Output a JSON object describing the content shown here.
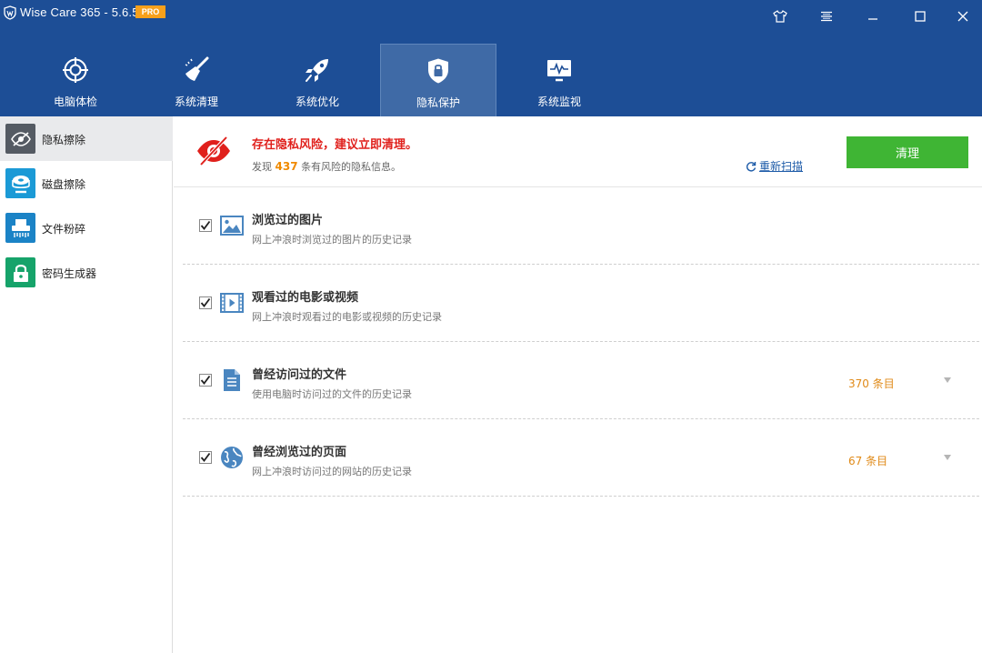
{
  "titlebar": {
    "title": "Wise Care 365 - 5.6.5",
    "badge": "PRO",
    "buttons": [
      "shirt-icon",
      "menu-icon",
      "minimize-icon",
      "maximize-icon",
      "close-icon"
    ]
  },
  "nav": {
    "tabs": [
      {
        "label": "电脑体检",
        "icon": "target-icon"
      },
      {
        "label": "系统清理",
        "icon": "broom-icon"
      },
      {
        "label": "系统优化",
        "icon": "rocket-icon"
      },
      {
        "label": "隐私保护",
        "icon": "shield-lock-icon",
        "active": true
      },
      {
        "label": "系统监视",
        "icon": "monitor-icon"
      }
    ]
  },
  "sidebar": {
    "items": [
      {
        "label": "隐私擦除",
        "icon": "eye-off-icon",
        "color": "#555b63",
        "active": true
      },
      {
        "label": "磁盘擦除",
        "icon": "disk-wipe-icon",
        "color": "#1b9ad6"
      },
      {
        "label": "文件粉碎",
        "icon": "shredder-icon",
        "color": "#1b83c6"
      },
      {
        "label": "密码生成器",
        "icon": "lock-icon",
        "color": "#16a36a"
      }
    ]
  },
  "status": {
    "title": "存在隐私风险，建议立即清理。",
    "sub_prefix": "发现",
    "count": "437",
    "sub_suffix": "条有风险的隐私信息。",
    "rescan_label": "重新扫描",
    "clean_label": "清理"
  },
  "items": [
    {
      "title": "浏览过的图片",
      "desc": "网上冲浪时浏览过的图片的历史记录",
      "count": "",
      "checked": true,
      "icon": "image-icon"
    },
    {
      "title": "观看过的电影或视频",
      "desc": "网上冲浪时观看过的电影或视频的历史记录",
      "count": "",
      "checked": true,
      "icon": "video-icon"
    },
    {
      "title": "曾经访问过的文件",
      "desc": "使用电脑时访问过的文件的历史记录",
      "count": "370 条目",
      "checked": true,
      "icon": "document-icon"
    },
    {
      "title": "曾经浏览过的页面",
      "desc": "网上冲浪时访问过的网站的历史记录",
      "count": "67 条目",
      "checked": true,
      "icon": "globe-icon"
    }
  ],
  "colors": {
    "brand": "#1d4e96",
    "danger": "#e0201c",
    "accent_green": "#3fb534",
    "count_orange": "#e08a18"
  }
}
